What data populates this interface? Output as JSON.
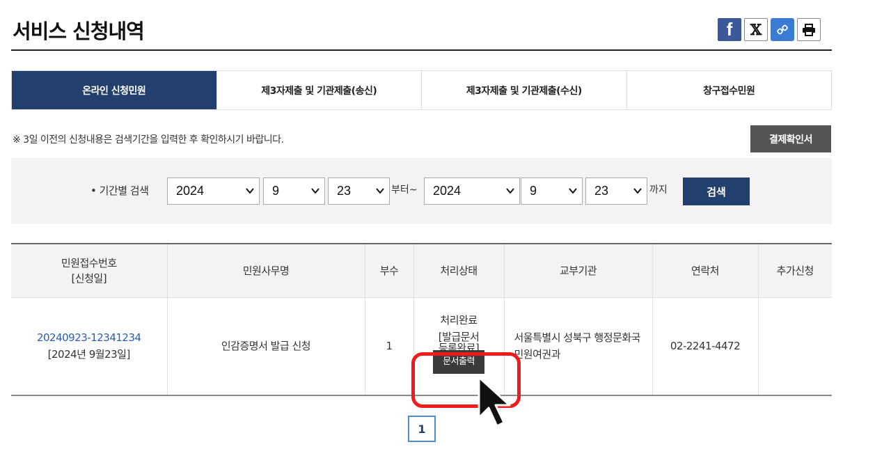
{
  "page": {
    "title": "서비스 신청내역"
  },
  "share": {
    "facebook": "f",
    "x": "𝕏",
    "link": "🔗"
  },
  "tabs": [
    {
      "label": "온라인 신청민원",
      "active": true
    },
    {
      "label": "제3자제출 및 기관제출(송신)",
      "active": false
    },
    {
      "label": "제3자제출 및 기관제출(수신)",
      "active": false
    },
    {
      "label": "창구접수민원",
      "active": false
    }
  ],
  "notice": "※ 3일 이전의 신청내용은 검색기간을 입력한 후 확인하시기 바랍니다.",
  "payment_button": "결제확인서",
  "search": {
    "label": "• 기간별 검색",
    "from": {
      "year": "2024",
      "month": "9",
      "day": "23"
    },
    "from_suffix": "부터~",
    "to": {
      "year": "2024",
      "month": "9",
      "day": "23"
    },
    "to_suffix": "까지",
    "button": "검색"
  },
  "table": {
    "headers": [
      "민원접수번호",
      "[신청일]",
      "민원사무명",
      "부수",
      "처리상태",
      "교부기관",
      "연락처",
      "추가신청"
    ],
    "rows": [
      {
        "receipt_no": "20240923-12341234",
        "date": "[2024년 9월23일]",
        "service": "인감증명서 발급 신청",
        "copies": "1",
        "status_line1": "처리완료",
        "status_line2": "[발급문서",
        "status_line3": "등록완료]",
        "print_button": "문서출력",
        "agency_line1": "서울특별시 성북구 행정문화국",
        "agency_line2": "민원여권과",
        "contact": "02-2241-4472",
        "extra": ""
      }
    ]
  },
  "pagination": {
    "current": "1"
  },
  "colors": {
    "navy": "#233f6e",
    "highlight": "#ee1c1c",
    "facebook": "#3b5998"
  }
}
